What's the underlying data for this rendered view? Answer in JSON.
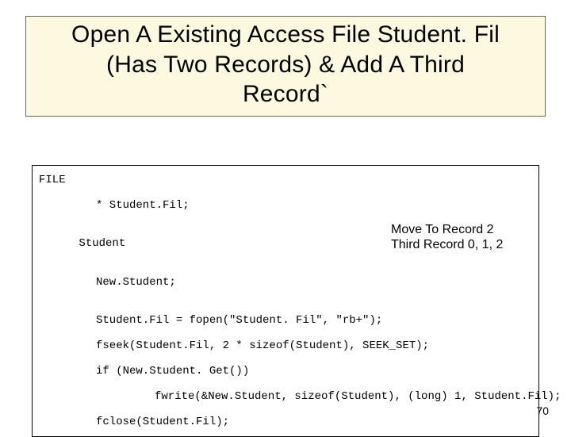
{
  "title": {
    "line1": "Open A Existing Access File Student. Fil",
    "line2": "(Has Two Records) & Add A Third",
    "line3": "Record`"
  },
  "code": {
    "l1": "FILE",
    "l2": "* Student.Fil;",
    "l3": "Student",
    "l4": "New.Student;",
    "l5": "Student.Fil = fopen(\"Student. Fil\", \"rb+\");",
    "l6": "fseek(Student.Fil, 2 * sizeof(Student), SEEK_SET);",
    "l7": "if (New.Student. Get())",
    "l8": "fwrite(&New.Student, sizeof(Student), (long) 1, Student.Fil);",
    "l9": "fclose(Student.Fil);"
  },
  "note": {
    "line1": "Move To Record 2",
    "line2": "Third Record 0, 1, 2"
  },
  "page_number": "70"
}
